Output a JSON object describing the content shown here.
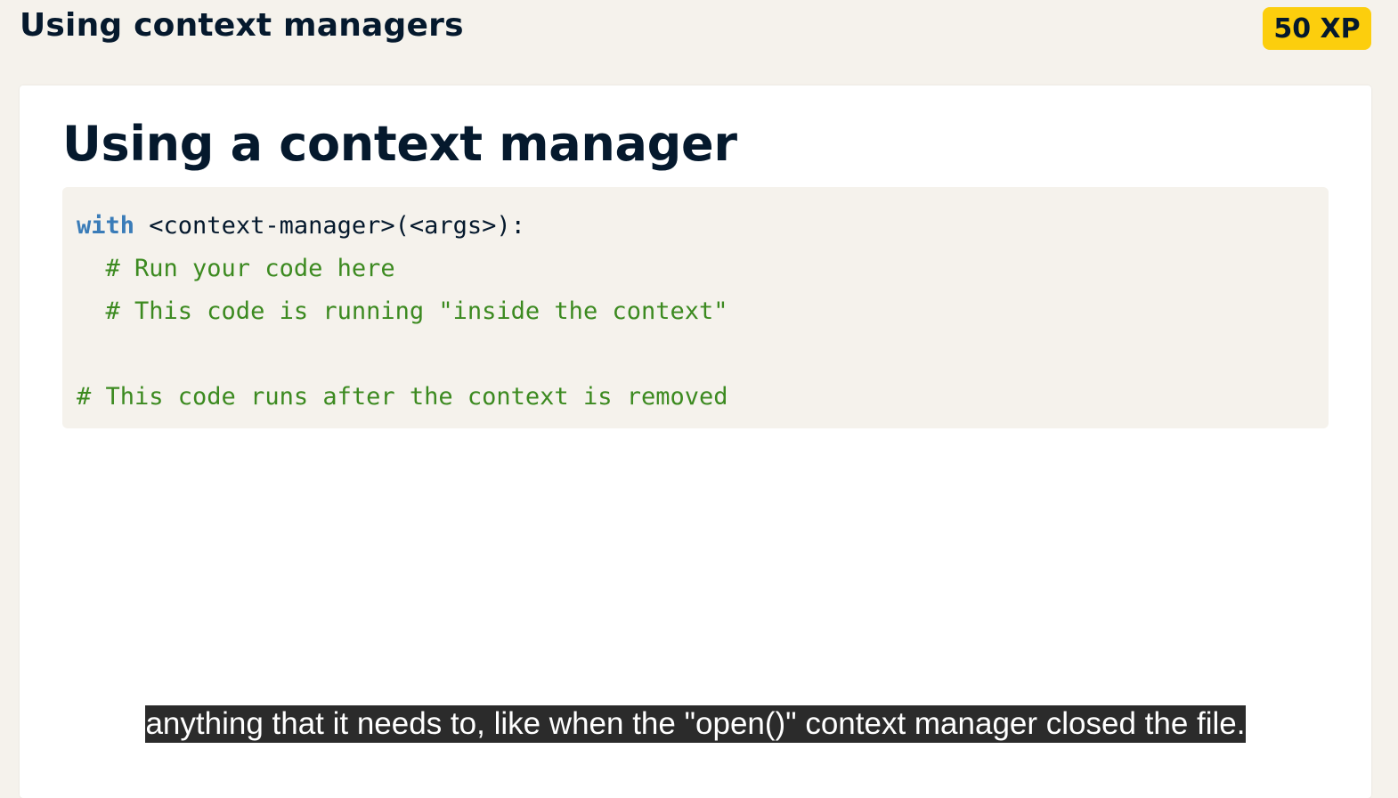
{
  "header": {
    "title": "Using context managers",
    "xp_badge": "50 XP"
  },
  "slide": {
    "title": "Using a context manager",
    "code": {
      "line1_keyword": "with",
      "line1_rest": " <context-manager>(<args>):",
      "line2": "  # Run your code here",
      "line3": "  # This code is running \"inside the context\"",
      "line5": "# This code runs after the context is removed"
    },
    "subtitle": "anything that it needs to, like when the \"open()\" context manager closed the file."
  },
  "colors": {
    "background": "#f5f2ec",
    "xp_badge": "#fcce0d",
    "keyword": "#3a7cb8",
    "comment": "#3c8a20",
    "text": "#05192d"
  }
}
